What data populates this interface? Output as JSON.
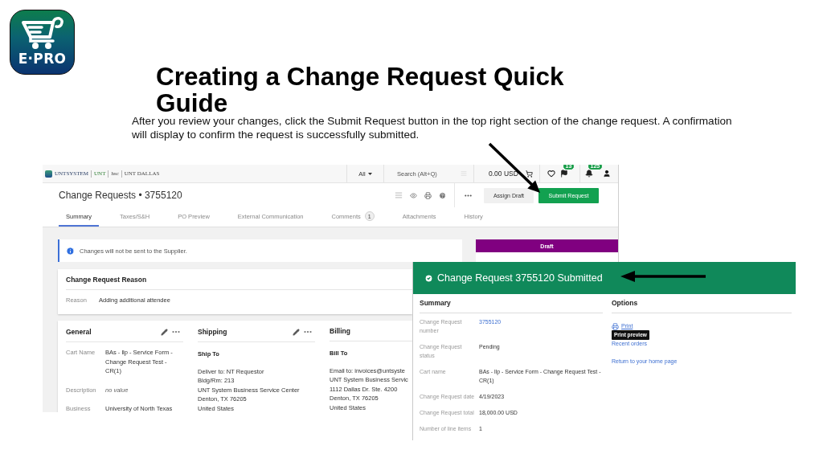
{
  "logo": {
    "text": "E·PRO"
  },
  "title": "Creating a Change Request Quick Guide",
  "description": "After you review your changes, click the Submit Request button in the top right section of the change request. A confirmation will display to confirm the request is successfully submitted.",
  "app_screenshot": {
    "top_bar": {
      "brands": [
        "UNTSYSTEM",
        "UNT",
        "hsc",
        "UNT DALLAS"
      ],
      "scope": "All",
      "search": {
        "placeholder": "Search (Alt+Q)"
      },
      "cart_total": "0.00 USD",
      "notifications": [
        {
          "kind": "flag",
          "badge": "13"
        },
        {
          "kind": "bell",
          "badge": "125"
        }
      ]
    },
    "header": {
      "title": "Change Requests • 3755120",
      "buttons": [
        {
          "label": "Assign Draft",
          "kind": "secondary"
        },
        {
          "label": "Submit Request",
          "kind": "primary"
        }
      ]
    },
    "tabs": [
      {
        "label": "Summary",
        "selected": true
      },
      {
        "label": "Taxes/S&H",
        "selected": false
      },
      {
        "label": "PO Preview",
        "selected": false
      },
      {
        "label": "External Communication",
        "selected": false
      },
      {
        "label": "Comments",
        "selected": false,
        "badge": "1"
      },
      {
        "label": "Attachments",
        "selected": false
      },
      {
        "label": "History",
        "selected": false
      }
    ],
    "notice": "Changes will not be sent to the Supplier.",
    "reason_card": {
      "title": "Change Request Reason",
      "label": "Reason",
      "value": "Adding additional attendee"
    },
    "sections": [
      {
        "kind": "fields",
        "title": "General",
        "actions": true,
        "fields": [
          {
            "label": "Cart Name",
            "value": "BAs - llp - Service Form - Change Request Test - CR(1)",
            "empty": false
          },
          {
            "label": "Description",
            "value": "no value",
            "empty": true
          },
          {
            "label": "Business",
            "value": "University of North Texas",
            "empty": false
          }
        ]
      },
      {
        "kind": "address",
        "title": "Shipping",
        "actions": true,
        "subtitle": "Ship To",
        "lines": [
          "Deliver to: NT Requestor",
          "Bldg/Rm: 213",
          "UNT System Business Service Center",
          "Denton, TX 76205",
          "United States"
        ]
      },
      {
        "kind": "address",
        "title": "Billing",
        "subtitle": "Bill To",
        "lines": [
          "Email to: invoices@untsyste",
          "UNT System Business Servic",
          "1112 Dallas Dr. Ste. 4200",
          "Denton, TX 76205",
          "United States"
        ]
      }
    ],
    "status_panel": {
      "status": "Draft"
    }
  },
  "confirmation": {
    "title": "Change Request 3755120 Submitted",
    "summary": {
      "heading": "Summary",
      "rows": [
        {
          "label": "Change Request number",
          "value": "3755120",
          "link": true
        },
        {
          "label": "Change Request status",
          "value": "Pending",
          "link": false
        },
        {
          "label": "Cart name",
          "value": "BAs - llp - Service Form - Change Request Test - CR(1)",
          "link": false
        },
        {
          "label": "Change Request date",
          "value": "4/19/2023",
          "link": false
        },
        {
          "label": "Change Request total",
          "value": "18,000.00 USD",
          "link": false
        },
        {
          "label": "Number of line items",
          "value": "1",
          "link": false
        }
      ]
    },
    "options": {
      "heading": "Options",
      "links": [
        {
          "label": "Print",
          "kind": "print"
        },
        {
          "label": "Recent orders",
          "kind": "plain"
        },
        {
          "label": "Return to your home page",
          "kind": "plain"
        }
      ],
      "tooltip": "Print preview"
    }
  }
}
